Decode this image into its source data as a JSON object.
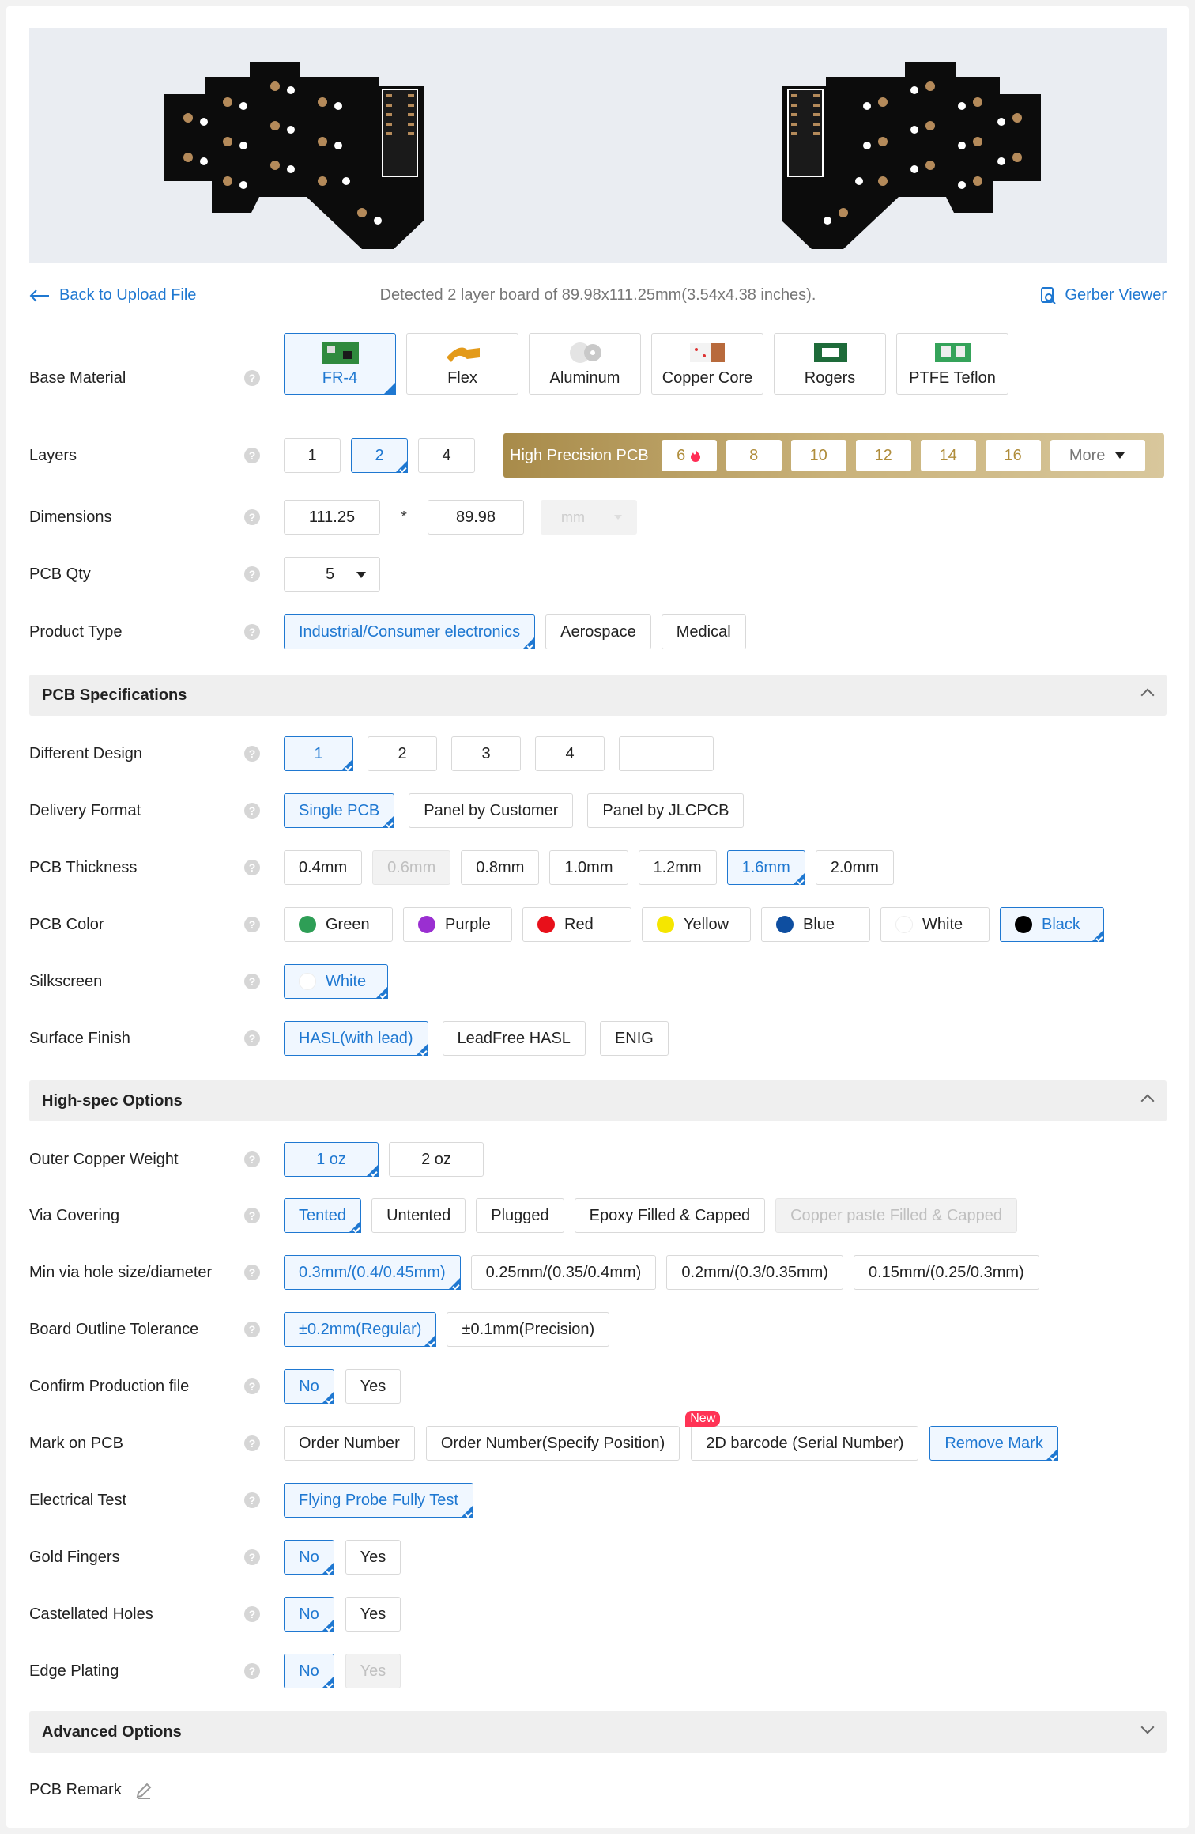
{
  "nav": {
    "back_label": "Back to Upload File",
    "gerber_label": "Gerber Viewer"
  },
  "detected_text": "Detected 2 layer board of 89.98x111.25mm(3.54x4.38 inches).",
  "base_material": {
    "label": "Base Material",
    "options": [
      "FR-4",
      "Flex",
      "Aluminum",
      "Copper Core",
      "Rogers",
      "PTFE Teflon"
    ],
    "selected": "FR-4"
  },
  "layers": {
    "label": "Layers",
    "options": [
      "1",
      "2",
      "4"
    ],
    "selected": "2",
    "hp_title": "High Precision PCB",
    "hp_options": [
      "6",
      "8",
      "10",
      "12",
      "14",
      "16"
    ],
    "more": "More"
  },
  "dimensions": {
    "label": "Dimensions",
    "width": "111.25",
    "times": "*",
    "height": "89.98",
    "unit": "mm"
  },
  "pcb_qty": {
    "label": "PCB Qty",
    "value": "5"
  },
  "product_type": {
    "label": "Product Type",
    "options": [
      "Industrial/Consumer electronics",
      "Aerospace",
      "Medical"
    ],
    "selected": "Industrial/Consumer electronics"
  },
  "sections": {
    "pcb_specs": "PCB Specifications",
    "high_spec": "High-spec Options",
    "advanced": "Advanced Options"
  },
  "different_design": {
    "label": "Different Design",
    "options": [
      "1",
      "2",
      "3",
      "4"
    ],
    "custom": "",
    "selected": "1"
  },
  "delivery_format": {
    "label": "Delivery Format",
    "options": [
      "Single PCB",
      "Panel by Customer",
      "Panel by JLCPCB"
    ],
    "selected": "Single PCB"
  },
  "thickness": {
    "label": "PCB Thickness",
    "options": [
      "0.4mm",
      "0.6mm",
      "0.8mm",
      "1.0mm",
      "1.2mm",
      "1.6mm",
      "2.0mm"
    ],
    "disabled": [
      "0.6mm"
    ],
    "selected": "1.6mm"
  },
  "pcb_color": {
    "label": "PCB Color",
    "options": [
      {
        "name": "Green",
        "color": "#2e9e56"
      },
      {
        "name": "Purple",
        "color": "#9a2fd1"
      },
      {
        "name": "Red",
        "color": "#e8101a"
      },
      {
        "name": "Yellow",
        "color": "#f5e600"
      },
      {
        "name": "Blue",
        "color": "#0e4ea0"
      },
      {
        "name": "White",
        "color": "#ffffff"
      },
      {
        "name": "Black",
        "color": "#000000"
      }
    ],
    "selected": "Black"
  },
  "silkscreen": {
    "label": "Silkscreen",
    "value": "White",
    "color": "#ffffff"
  },
  "surface_finish": {
    "label": "Surface Finish",
    "options": [
      "HASL(with lead)",
      "LeadFree HASL",
      "ENIG"
    ],
    "selected": "HASL(with lead)"
  },
  "outer_copper": {
    "label": "Outer Copper Weight",
    "options": [
      "1 oz",
      "2 oz"
    ],
    "selected": "1 oz"
  },
  "via_covering": {
    "label": "Via Covering",
    "options": [
      "Tented",
      "Untented",
      "Plugged",
      "Epoxy Filled & Capped",
      "Copper paste Filled & Capped"
    ],
    "disabled": [
      "Copper paste Filled & Capped"
    ],
    "selected": "Tented"
  },
  "min_via": {
    "label": "Min via hole size/diameter",
    "options": [
      "0.3mm/(0.4/0.45mm)",
      "0.25mm/(0.35/0.4mm)",
      "0.2mm/(0.3/0.35mm)",
      "0.15mm/(0.25/0.3mm)"
    ],
    "selected": "0.3mm/(0.4/0.45mm)"
  },
  "outline_tol": {
    "label": "Board Outline Tolerance",
    "options": [
      "±0.2mm(Regular)",
      "±0.1mm(Precision)"
    ],
    "selected": "±0.2mm(Regular)"
  },
  "confirm_file": {
    "label": "Confirm Production file",
    "options": [
      "No",
      "Yes"
    ],
    "selected": "No"
  },
  "mark_on_pcb": {
    "label": "Mark on PCB",
    "options": [
      "Order Number",
      "Order Number(Specify Position)",
      "2D barcode (Serial Number)",
      "Remove Mark"
    ],
    "badge": "New",
    "selected": "Remove Mark"
  },
  "electrical_test": {
    "label": "Electrical Test",
    "options": [
      "Flying Probe Fully Test"
    ],
    "selected": "Flying Probe Fully Test"
  },
  "gold_fingers": {
    "label": "Gold Fingers",
    "options": [
      "No",
      "Yes"
    ],
    "selected": "No"
  },
  "castellated": {
    "label": "Castellated Holes",
    "options": [
      "No",
      "Yes"
    ],
    "selected": "No"
  },
  "edge_plating": {
    "label": "Edge Plating",
    "options": [
      "No",
      "Yes"
    ],
    "disabled": [
      "Yes"
    ],
    "selected": "No"
  },
  "pcb_remark": {
    "label": "PCB Remark"
  },
  "help_glyph": "?"
}
